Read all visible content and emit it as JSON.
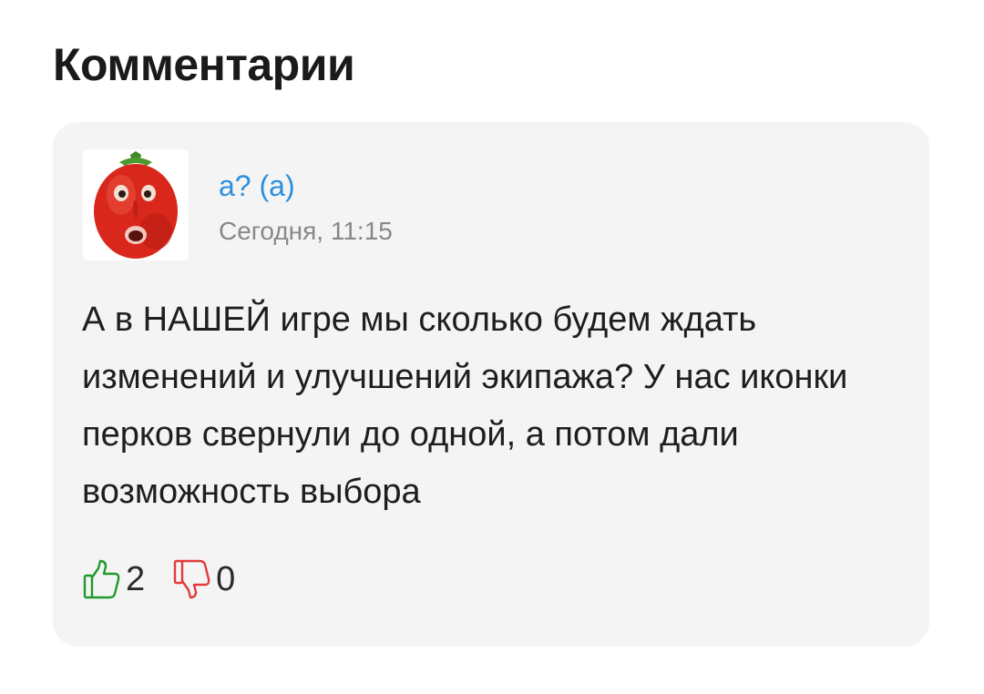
{
  "page": {
    "title": "Комментарии"
  },
  "comment": {
    "author": "a? (a)",
    "date": "Сегодня, 11:15",
    "text": "А в НАШЕЙ игре мы сколько будем ждать изменений и улучшений экипажа? У нас иконки перков свернули до одной, а потом дали возможность выбора",
    "avatar": "tomato-face-avatar",
    "likes": "2",
    "dislikes": "0"
  },
  "icons": {
    "like": "thumbs-up-icon",
    "dislike": "thumbs-down-icon"
  },
  "colors": {
    "author_link": "#2b8fe0",
    "like": "#1f9a2a",
    "dislike": "#e23b3b",
    "card_background": "#f4f4f4"
  }
}
